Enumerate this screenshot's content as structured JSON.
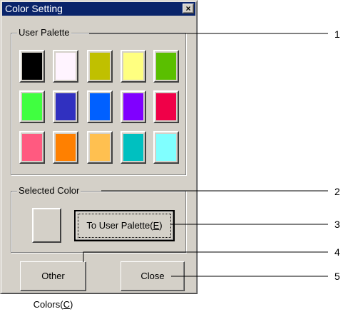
{
  "window": {
    "title": "Color Setting",
    "close_glyph": "×"
  },
  "user_palette": {
    "label": "User Palette",
    "colors": [
      [
        "#000000",
        "#fff4ff",
        "#c0c000",
        "#ffff80",
        "#5abf00"
      ],
      [
        "#40ff40",
        "#3030c0",
        "#0060ff",
        "#8000ff",
        "#f00048"
      ],
      [
        "#ff5a80",
        "#ff8000",
        "#ffc050",
        "#00c0c0",
        "#80ffff"
      ]
    ]
  },
  "selected_color": {
    "label": "Selected Color",
    "to_user_palette_label": "To User Palette(",
    "to_user_palette_key": "E",
    "to_user_palette_suffix": ")"
  },
  "buttons": {
    "other_colors_label": "Other Colors(",
    "other_colors_key": "C",
    "other_colors_suffix": ")",
    "close_label": "Close"
  },
  "callouts": [
    "1",
    "2",
    "3",
    "4",
    "5"
  ]
}
